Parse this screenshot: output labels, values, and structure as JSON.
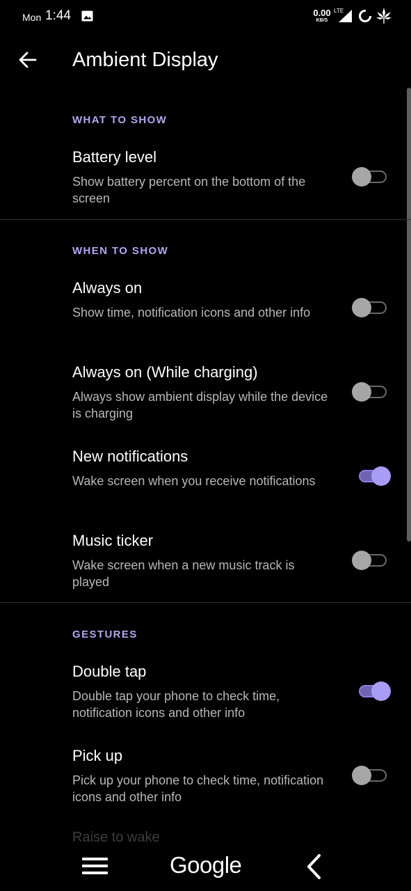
{
  "status_bar": {
    "day": "Mon",
    "time": "1:44",
    "net_speed_value": "0.00",
    "net_speed_unit": "KB/S",
    "network_type": "LTE",
    "icons": [
      "image-icon",
      "signal-icon",
      "loading-ring-icon",
      "leaf-icon"
    ]
  },
  "app_bar": {
    "title": "Ambient Display",
    "back_icon": "arrow-back-icon"
  },
  "sections": [
    {
      "header": "WHAT TO SHOW",
      "items": [
        {
          "title": "Battery level",
          "summary": "Show battery percent on the bottom of the screen",
          "enabled": false
        }
      ]
    },
    {
      "header": "WHEN TO SHOW",
      "items": [
        {
          "title": "Always on",
          "summary": "Show time, notification icons and other info",
          "enabled": false
        },
        {
          "title": "Always on (While charging)",
          "summary": "Always show ambient display while the device is charging",
          "enabled": false
        },
        {
          "title": "New notifications",
          "summary": "Wake screen when you receive notifications",
          "enabled": true
        },
        {
          "title": "Music ticker",
          "summary": "Wake screen when a new music track is played",
          "enabled": false
        }
      ]
    },
    {
      "header": "GESTURES",
      "items": [
        {
          "title": "Double tap",
          "summary": "Double tap your phone to check time, notification icons and other info",
          "enabled": true
        },
        {
          "title": "Pick up",
          "summary": "Pick up your phone to check time, notification icons and other info",
          "enabled": false
        },
        {
          "title": "Raise to wake"
        }
      ]
    }
  ],
  "nav_bar": {
    "menu_icon": "hamburger-menu-icon",
    "center_label": "Google",
    "back_icon": "chevron-back-icon"
  },
  "colors": {
    "background": "#000000",
    "accent": "#b4a6f1",
    "switch_on_thumb": "#a89cf4",
    "switch_off_thumb": "#a6a6a6",
    "summary_text": "#b8b8b8"
  }
}
